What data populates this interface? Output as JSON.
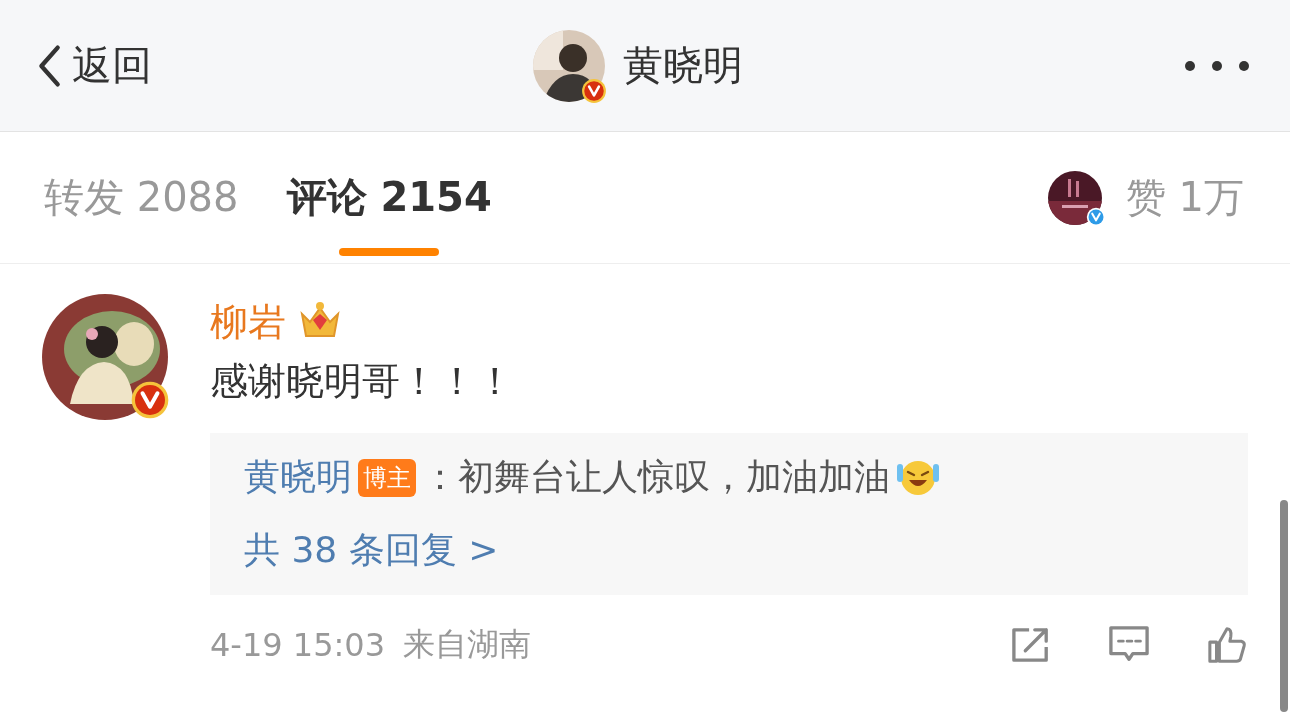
{
  "header": {
    "back_label": "返回",
    "title": "黄晓明"
  },
  "tabs": [
    {
      "kind": "count",
      "label": "转发",
      "count": "2088",
      "selected": false
    },
    {
      "kind": "count",
      "label": "评论",
      "count": "2154",
      "selected": true
    },
    {
      "kind": "likes",
      "label": "赞",
      "count": "1万",
      "selected": false
    }
  ],
  "comment": {
    "author": "柳岩",
    "text": "感谢晓明哥！！！",
    "reply": {
      "author": "黄晓明",
      "badge": "博主",
      "text": "：初舞台让人惊叹，加油加油"
    },
    "more_replies": "共 38 条回复 >",
    "time": "4-19 15:03",
    "location": "来自湖南"
  }
}
